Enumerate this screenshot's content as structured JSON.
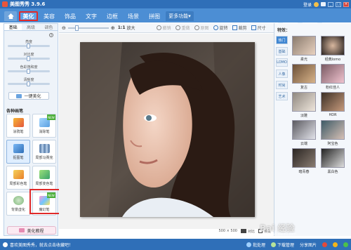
{
  "app": {
    "title": "美图秀秀 3.9.6"
  },
  "titlebar": {
    "login": "登录"
  },
  "tabs": [
    {
      "label": "美化"
    },
    {
      "label": "美容"
    },
    {
      "label": "饰品"
    },
    {
      "label": "文字"
    },
    {
      "label": "边框"
    },
    {
      "label": "场景"
    },
    {
      "label": "拼图"
    },
    {
      "label": "更多功能"
    }
  ],
  "top_right": {
    "open": "打开",
    "new": "新建",
    "save": "保存与分享"
  },
  "left_panel": {
    "subtabs": [
      "基础",
      "高级",
      "调色"
    ],
    "sliders": [
      {
        "label": "亮度",
        "value": 0.5
      },
      {
        "label": "对比度",
        "value": 0.5
      },
      {
        "label": "色彩饱和度",
        "value": 0.5
      },
      {
        "label": "清晰度",
        "value": 0.5
      }
    ],
    "auto_button": "一键美化",
    "section_title": "各种画笔",
    "tools": [
      {
        "label": "涂鸦笔"
      },
      {
        "label": "消除笔"
      },
      {
        "label": "抠图笔"
      },
      {
        "label": "局部马赛克"
      },
      {
        "label": "局部彩色笔"
      },
      {
        "label": "局部变色笔"
      },
      {
        "label": "背景虚化"
      },
      {
        "label": "魔幻笔"
      }
    ],
    "new_tag": "NEW",
    "bottom_button": "美化教程"
  },
  "toolbar": {
    "zoom_ratio": "1:1",
    "enlarge": "放大",
    "undo": "撤销",
    "redo": "重做",
    "original": "原图",
    "rotate": "旋转",
    "crop": "裁剪",
    "size": "尺寸"
  },
  "canvas": {
    "dimensions": "500 × 500",
    "compare": "对比",
    "preview": "预览"
  },
  "right_panel": {
    "title": "特效：",
    "categories": [
      "热门",
      "基础",
      "LOMO",
      "人像",
      "时尚",
      "艺术"
    ],
    "effects": [
      {
        "label": "柔光"
      },
      {
        "label": "经典lomo"
      },
      {
        "label": "复古"
      },
      {
        "label": "粉红佳人"
      },
      {
        "label": "淡雅"
      },
      {
        "label": "HDR"
      },
      {
        "label": "云端"
      },
      {
        "label": "阿宝色"
      },
      {
        "label": "暗青春"
      },
      {
        "label": "黑白色"
      }
    ]
  },
  "statusbar": {
    "tip": "喜欢美图秀秀，就去点击收藏吧！",
    "batch": "批处理",
    "download": "下载管理",
    "share": "分享图片"
  },
  "watermark": "Bai 经验",
  "watermark_url": "jingyan.baidu.com",
  "colors": {
    "title_blue": "#2f6fb8",
    "tab_blue": "#4c8ed4",
    "highlight_red": "#e02a2a",
    "active_cat": "#3f86d2"
  }
}
